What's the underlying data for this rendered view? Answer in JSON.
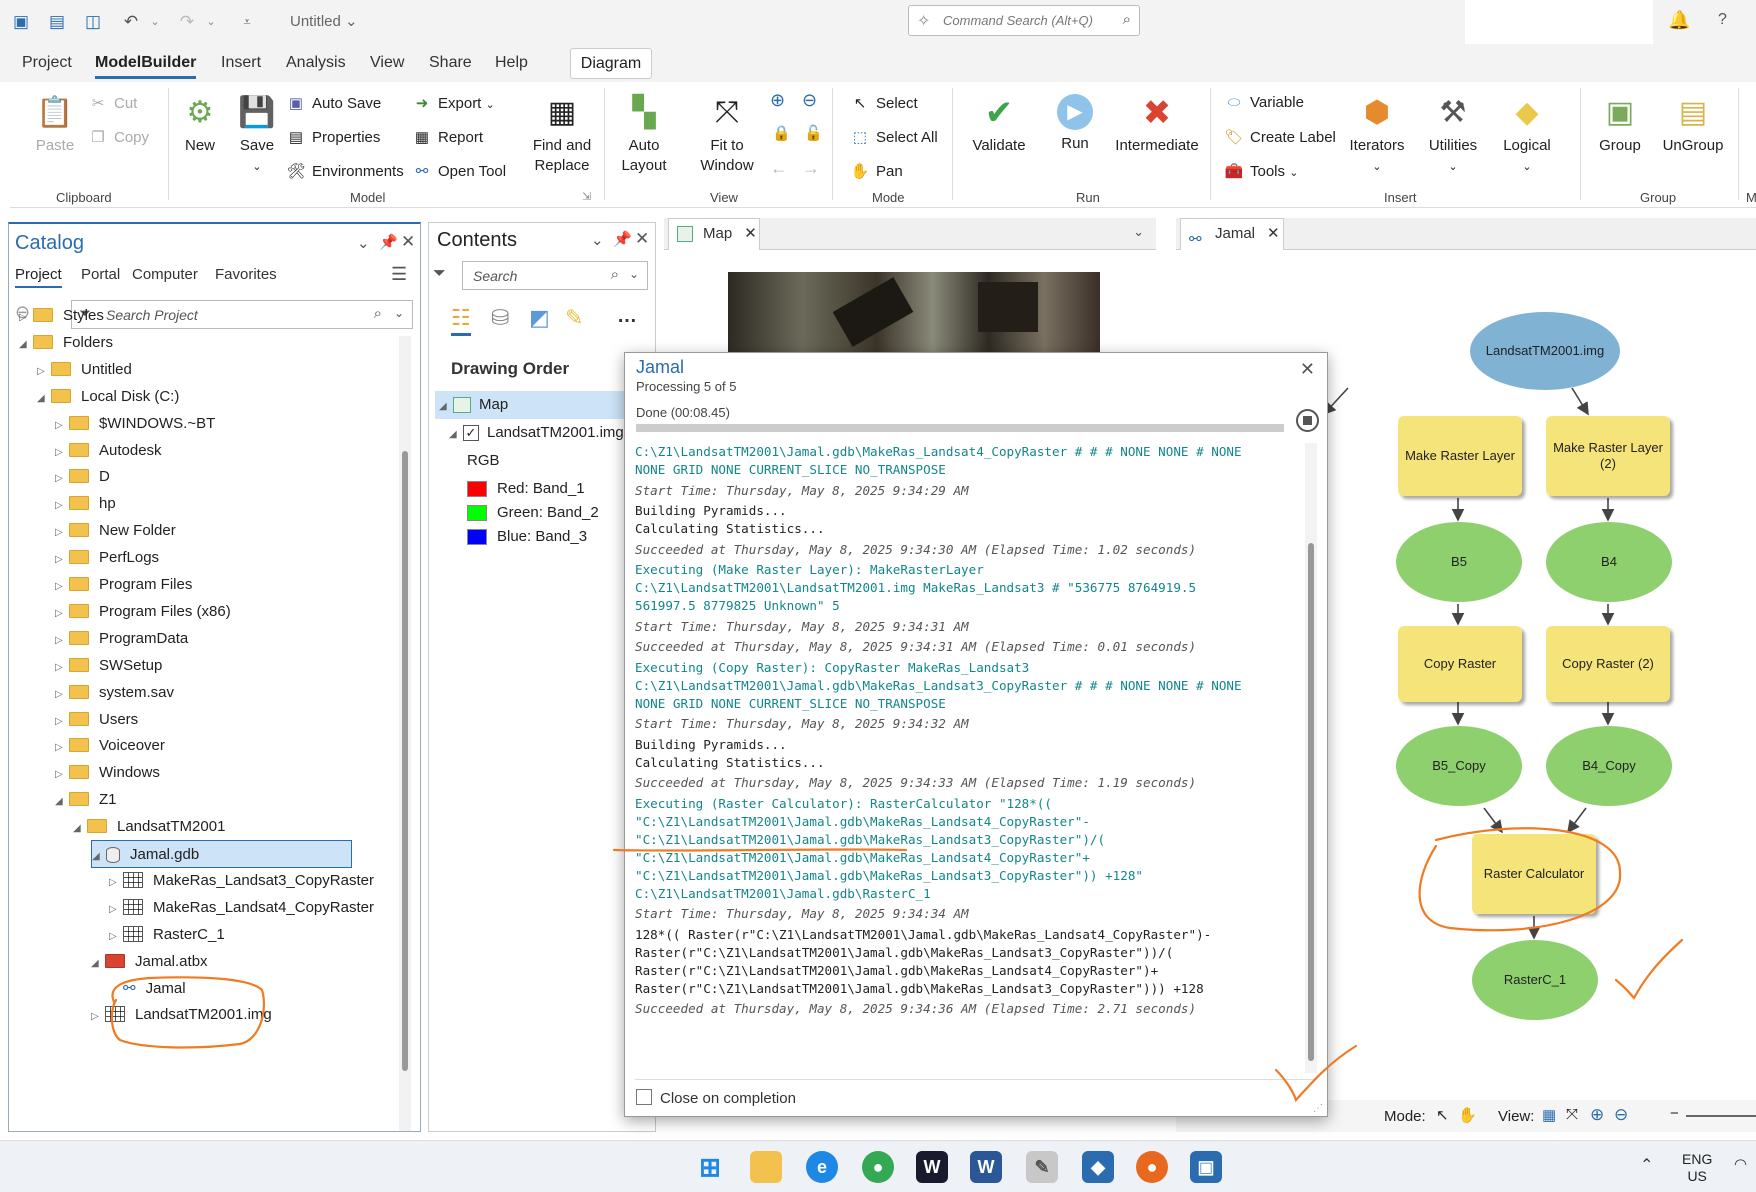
{
  "titlebar": {
    "doc_title": "Untitled",
    "command_search_placeholder": "Command Search (Alt+Q)"
  },
  "menu": {
    "items": [
      "Project",
      "ModelBuilder",
      "Insert",
      "Analysis",
      "View",
      "Share",
      "Help"
    ],
    "active": "ModelBuilder",
    "context_tab": "Diagram"
  },
  "ribbon": {
    "clipboard": {
      "group": "Clipboard",
      "paste": "Paste",
      "cut": "Cut",
      "copy": "Copy"
    },
    "model": {
      "group": "Model",
      "new": "New",
      "save": "Save",
      "auto_save": "Auto Save",
      "properties": "Properties",
      "environments": "Environments",
      "export": "Export",
      "report": "Report",
      "open_tool": "Open Tool",
      "find_replace_1": "Find and",
      "find_replace_2": "Replace"
    },
    "view": {
      "group": "View",
      "auto_layout_1": "Auto",
      "auto_layout_2": "Layout",
      "fit_1": "Fit to",
      "fit_2": "Window"
    },
    "mode": {
      "group": "Mode",
      "select": "Select",
      "select_all": "Select All",
      "pan": "Pan"
    },
    "run": {
      "group": "Run",
      "validate": "Validate",
      "run": "Run",
      "intermediate": "Intermediate"
    },
    "insert": {
      "group": "Insert",
      "variable": "Variable",
      "create_label": "Create Label",
      "tools": "Tools",
      "iterators": "Iterators",
      "utilities": "Utilities",
      "logical": "Logical"
    },
    "group": {
      "group": "Group",
      "group_btn": "Group",
      "ungroup": "UnGroup",
      "cut_label": "M"
    }
  },
  "catalog": {
    "title": "Catalog",
    "tabs": [
      "Project",
      "Portal",
      "Computer",
      "Favorites"
    ],
    "active_tab": "Project",
    "search_placeholder": "Search Project",
    "tree": [
      {
        "label": "Styles",
        "level": 1,
        "expanded": false
      },
      {
        "label": "Folders",
        "level": 1,
        "expanded": true
      },
      {
        "label": "Untitled",
        "level": 2,
        "expanded": false
      },
      {
        "label": "Local Disk (C:)",
        "level": 2,
        "expanded": true
      },
      {
        "label": "$WINDOWS.~BT",
        "level": 3,
        "expanded": false
      },
      {
        "label": "Autodesk",
        "level": 3,
        "expanded": false
      },
      {
        "label": "D",
        "level": 3,
        "expanded": false
      },
      {
        "label": "hp",
        "level": 3,
        "expanded": false
      },
      {
        "label": "New Folder",
        "level": 3,
        "expanded": false
      },
      {
        "label": "PerfLogs",
        "level": 3,
        "expanded": false
      },
      {
        "label": "Program Files",
        "level": 3,
        "expanded": false
      },
      {
        "label": "Program Files (x86)",
        "level": 3,
        "expanded": false
      },
      {
        "label": "ProgramData",
        "level": 3,
        "expanded": false
      },
      {
        "label": "SWSetup",
        "level": 3,
        "expanded": false
      },
      {
        "label": "system.sav",
        "level": 3,
        "expanded": false
      },
      {
        "label": "Users",
        "level": 3,
        "expanded": false
      },
      {
        "label": "Voiceover",
        "level": 3,
        "expanded": false
      },
      {
        "label": "Windows",
        "level": 3,
        "expanded": false
      },
      {
        "label": "Z1",
        "level": 3,
        "expanded": true
      },
      {
        "label": "LandsatTM2001",
        "level": 4,
        "expanded": true
      },
      {
        "label": "Jamal.gdb",
        "level": 5,
        "expanded": true
      },
      {
        "label": "MakeRas_Landsat3_CopyRaster",
        "level": 6,
        "expanded": false
      },
      {
        "label": "MakeRas_Landsat4_CopyRaster",
        "level": 6,
        "expanded": false
      },
      {
        "label": "RasterC_1",
        "level": 6,
        "expanded": false
      },
      {
        "label": "Jamal.atbx",
        "level": 5,
        "expanded": true
      },
      {
        "label": "Jamal",
        "level": 6,
        "expanded": false
      },
      {
        "label": "LandsatTM2001.img",
        "level": 5,
        "expanded": false
      }
    ]
  },
  "contents": {
    "title": "Contents",
    "search_placeholder": "Search",
    "drawing_order": "Drawing Order",
    "map": "Map",
    "layer": "LandsatTM2001.img",
    "rgb": "RGB",
    "bands": [
      {
        "label": "Red:  Band_1",
        "color": "#ff0000"
      },
      {
        "label": "Green: Band_2",
        "color": "#00ff00"
      },
      {
        "label": "Blue:  Band_3",
        "color": "#0000ff"
      }
    ]
  },
  "views": {
    "map_tab": "Map",
    "model_tab": "Jamal"
  },
  "model": {
    "nodes": {
      "input": "LandsatTM2001.img",
      "mrl1": "Make Raster Layer",
      "mrl2": "Make Raster Layer (2)",
      "b5": "B5",
      "b4": "B4",
      "cr1": "Copy Raster",
      "cr2": "Copy Raster (2)",
      "b5c": "B5_Copy",
      "b4c": "B4_Copy",
      "calc": "Raster Calculator",
      "out": "RasterC_1"
    },
    "colors": {
      "input": "#7fb2d3",
      "tool": "#f5e47a",
      "data": "#8ecf6e"
    }
  },
  "dialog": {
    "title": "Jamal",
    "processing": "Processing 5 of 5",
    "done": "Done (00:08.45)",
    "close_on_completion": "Close on completion",
    "log": [
      {
        "t": "cmd",
        "text": "C:\\Z1\\LandsatTM2001\\Jamal.gdb\\MakeRas_Landsat4_CopyRaster # # # NONE NONE # NONE"
      },
      {
        "t": "cmd",
        "text": "NONE GRID NONE CURRENT_SLICE NO_TRANSPOSE"
      },
      {
        "t": "time",
        "text": "Start Time: Thursday, May 8, 2025 9:34:29 AM"
      },
      {
        "t": "plain",
        "text": "Building Pyramids..."
      },
      {
        "t": "plain",
        "text": "Calculating Statistics..."
      },
      {
        "t": "time",
        "text": "Succeeded at Thursday, May 8, 2025 9:34:30 AM (Elapsed Time: 1.02 seconds)"
      },
      {
        "t": "cmd",
        "text": "Executing (Make Raster Layer): MakeRasterLayer"
      },
      {
        "t": "cmd",
        "text": "C:\\Z1\\LandsatTM2001\\LandsatTM2001.img MakeRas_Landsat3 # \"536775 8764919.5"
      },
      {
        "t": "cmd",
        "text": "561997.5 8779825 Unknown\" 5"
      },
      {
        "t": "time",
        "text": "Start Time: Thursday, May 8, 2025 9:34:31 AM"
      },
      {
        "t": "time",
        "text": "Succeeded at Thursday, May 8, 2025 9:34:31 AM (Elapsed Time: 0.01 seconds)"
      },
      {
        "t": "cmd",
        "text": "Executing (Copy Raster): CopyRaster MakeRas_Landsat3"
      },
      {
        "t": "cmd",
        "text": "C:\\Z1\\LandsatTM2001\\Jamal.gdb\\MakeRas_Landsat3_CopyRaster # # # NONE NONE # NONE"
      },
      {
        "t": "cmd",
        "text": "NONE GRID NONE CURRENT_SLICE NO_TRANSPOSE"
      },
      {
        "t": "time",
        "text": "Start Time: Thursday, May 8, 2025 9:34:32 AM"
      },
      {
        "t": "plain",
        "text": "Building Pyramids..."
      },
      {
        "t": "plain",
        "text": "Calculating Statistics..."
      },
      {
        "t": "time",
        "text": "Succeeded at Thursday, May 8, 2025 9:34:33 AM (Elapsed Time: 1.19 seconds)"
      },
      {
        "t": "cmd",
        "text": "Executing (Raster Calculator): RasterCalculator \"128*(("
      },
      {
        "t": "cmd",
        "text": "\"C:\\Z1\\LandsatTM2001\\Jamal.gdb\\MakeRas_Landsat4_CopyRaster\"-"
      },
      {
        "t": "cmd",
        "text": "\"C:\\Z1\\LandsatTM2001\\Jamal.gdb\\MakeRas_Landsat3_CopyRaster\")/("
      },
      {
        "t": "cmd",
        "text": "\"C:\\Z1\\LandsatTM2001\\Jamal.gdb\\MakeRas_Landsat4_CopyRaster\"+"
      },
      {
        "t": "cmd",
        "text": "\"C:\\Z1\\LandsatTM2001\\Jamal.gdb\\MakeRas_Landsat3_CopyRaster\")) +128\""
      },
      {
        "t": "cmd",
        "text": "C:\\Z1\\LandsatTM2001\\Jamal.gdb\\RasterC_1"
      },
      {
        "t": "time",
        "text": "Start Time: Thursday, May 8, 2025 9:34:34 AM"
      },
      {
        "t": "plain",
        "text": "128*(( Raster(r\"C:\\Z1\\LandsatTM2001\\Jamal.gdb\\MakeRas_Landsat4_CopyRaster\")-"
      },
      {
        "t": "plain",
        "text": "Raster(r\"C:\\Z1\\LandsatTM2001\\Jamal.gdb\\MakeRas_Landsat3_CopyRaster\"))/("
      },
      {
        "t": "plain",
        "text": "Raster(r\"C:\\Z1\\LandsatTM2001\\Jamal.gdb\\MakeRas_Landsat4_CopyRaster\")+"
      },
      {
        "t": "plain",
        "text": "Raster(r\"C:\\Z1\\LandsatTM2001\\Jamal.gdb\\MakeRas_Landsat3_CopyRaster\"))) +128"
      },
      {
        "t": "time",
        "text": "Succeeded at Thursday, May 8, 2025 9:34:36 AM (Elapsed Time: 2.71 seconds)"
      }
    ]
  },
  "statusbar": {
    "mode": "Mode:",
    "view": "View:"
  },
  "taskbar": {
    "lang_1": "ENG",
    "lang_2": "US"
  },
  "colors": {
    "accent": "#2b6cb0",
    "annotation": "#f07b22"
  }
}
